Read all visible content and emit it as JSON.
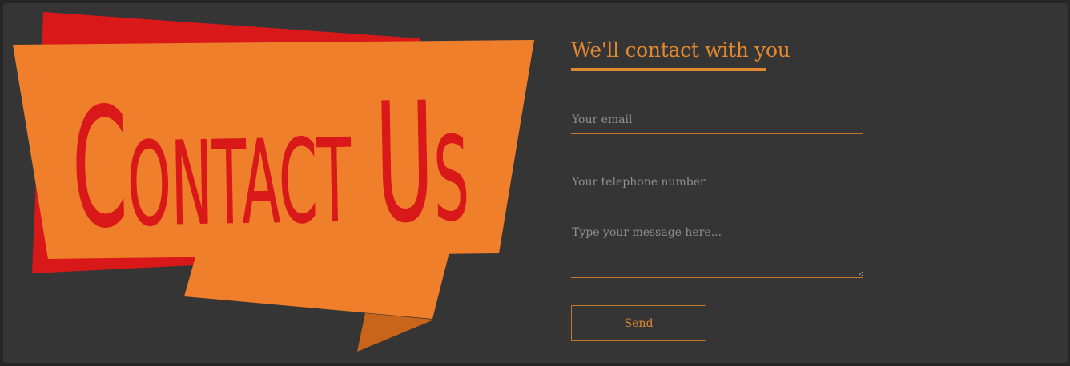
{
  "banner": {
    "text": "Contact Us",
    "colors": {
      "back_ribbon": "#d91919",
      "front_ribbon": "#ef7f2a",
      "fold_shadow": "#c9651a",
      "text": "#d91919"
    }
  },
  "form": {
    "heading": "We'll contact with you",
    "email_placeholder": "Your email",
    "phone_placeholder": "Your telephone number",
    "message_placeholder": "Type your message here...",
    "send_label": "Send"
  },
  "colors": {
    "background": "#353535",
    "accent": "#e2882f"
  }
}
